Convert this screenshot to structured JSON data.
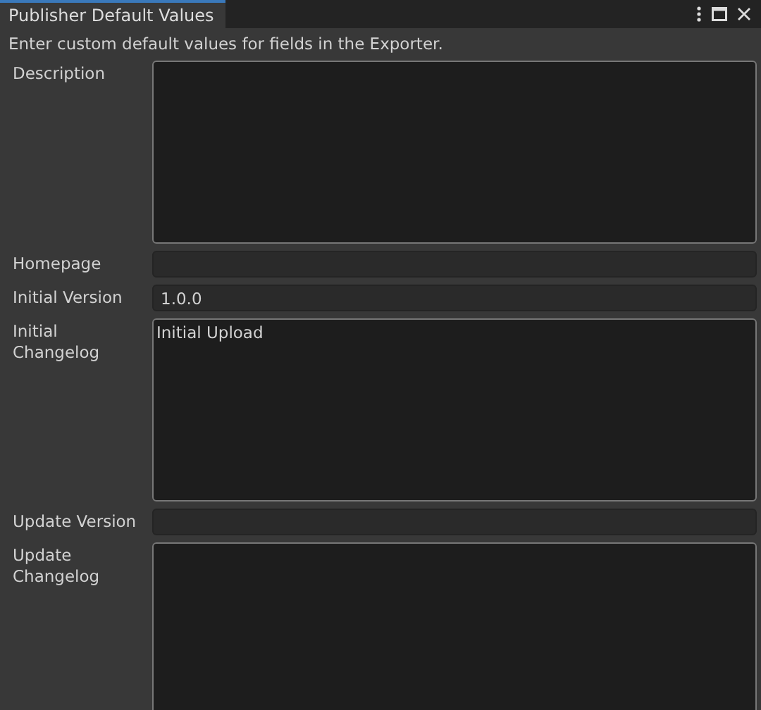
{
  "window": {
    "tab": {
      "label": "Publisher Default Values",
      "selected": true
    }
  },
  "intro": "Enter custom default values for fields in the Exporter.",
  "fields": [
    {
      "label": "Description",
      "kind": "multi"
    },
    {
      "label": "Homepage",
      "kind": "single"
    },
    {
      "label": "Initial Version",
      "kind": "single",
      "value": "1.0.0"
    },
    {
      "label": "Initial Changelog",
      "kind": "multi",
      "value": "Initial Upload"
    },
    {
      "label": "Update Version",
      "kind": "single"
    },
    {
      "label": "Update Changelog",
      "kind": "multi"
    }
  ]
}
